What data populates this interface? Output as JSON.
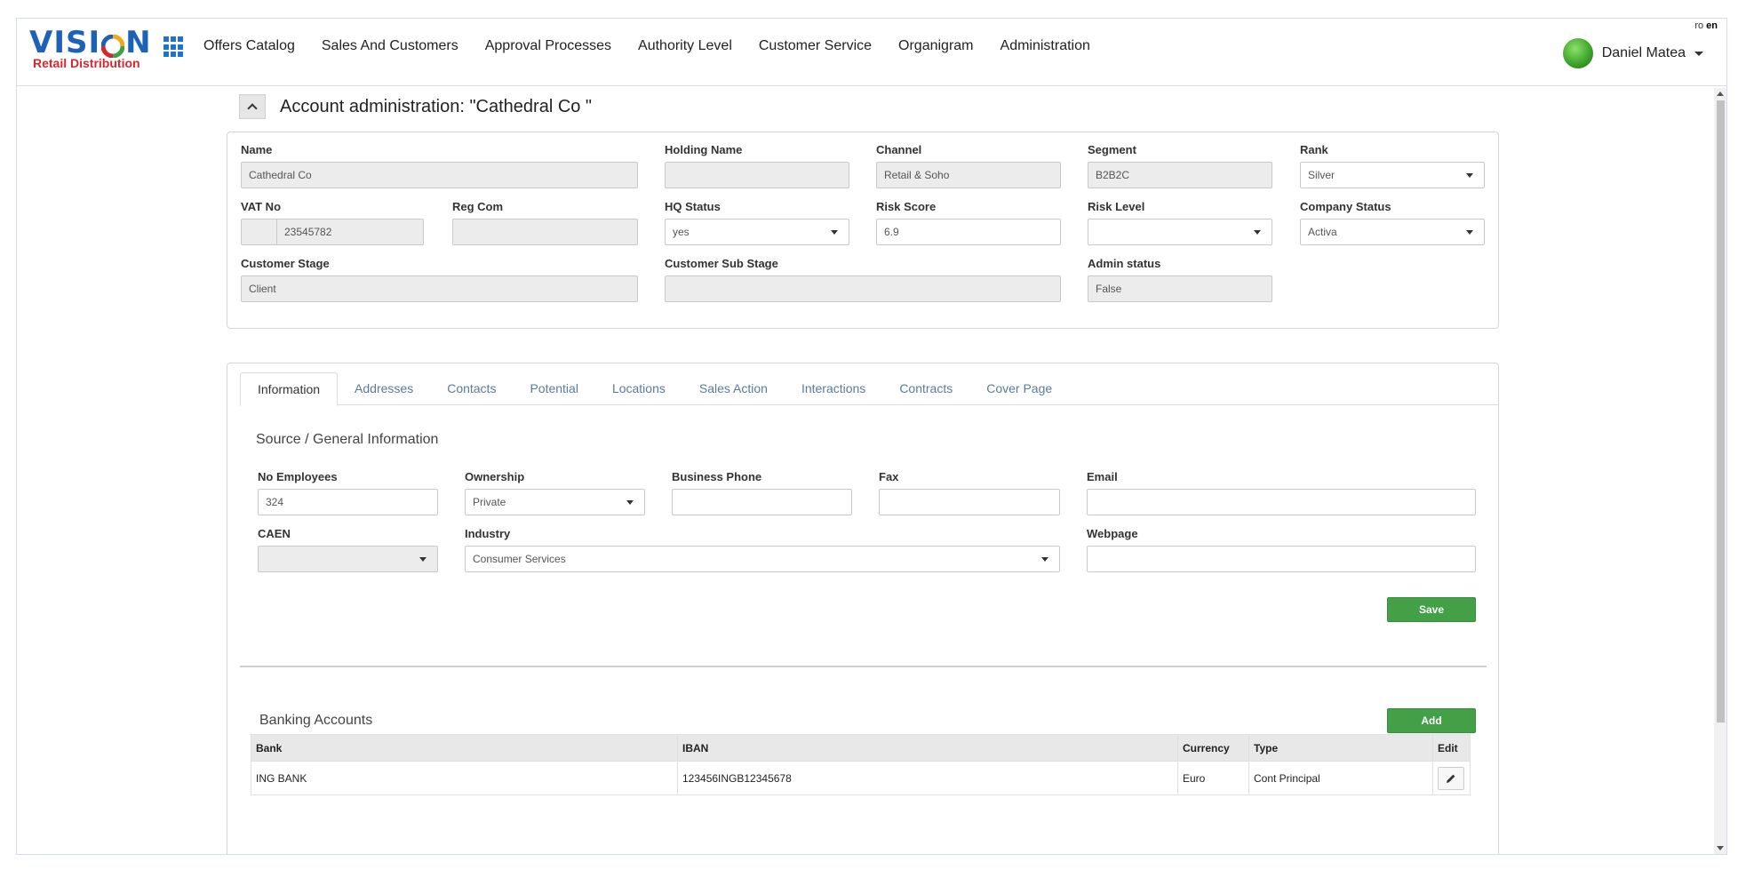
{
  "header": {
    "logo_text_left": "VISI",
    "logo_text_right": "N",
    "logo_subtitle": "Retail Distribution",
    "nav": [
      "Offers Catalog",
      "Sales And Customers",
      "Approval Processes",
      "Authority Level",
      "Customer Service",
      "Organigram",
      "Administration"
    ],
    "lang_ro": "ro",
    "lang_en": "en",
    "user_name": "Daniel Matea"
  },
  "page": {
    "title": "Account administration: \"Cathedral Co \""
  },
  "account": {
    "name_label": "Name",
    "name_value": "Cathedral Co",
    "holding_label": "Holding Name",
    "holding_value": "",
    "channel_label": "Channel",
    "channel_value": "Retail & Soho",
    "segment_label": "Segment",
    "segment_value": "B2B2C",
    "rank_label": "Rank",
    "rank_value": "Silver",
    "vat_label": "VAT No",
    "vat_value": "23545782",
    "regcom_label": "Reg Com",
    "regcom_value": "",
    "hq_label": "HQ Status",
    "hq_value": "yes",
    "risk_score_label": "Risk Score",
    "risk_score_value": "6.9",
    "risk_level_label": "Risk Level",
    "risk_level_value": "",
    "company_status_label": "Company Status",
    "company_status_value": "Activa",
    "stage_label": "Customer Stage",
    "stage_value": "Client",
    "substage_label": "Customer Sub Stage",
    "substage_value": "",
    "admin_label": "Admin status",
    "admin_value": "False"
  },
  "tabs": [
    "Information",
    "Addresses",
    "Contacts",
    "Potential",
    "Locations",
    "Sales Action",
    "Interactions",
    "Contracts",
    "Cover Page"
  ],
  "info": {
    "section_title": "Source / General Information",
    "employees_label": "No Employees",
    "employees_value": "324",
    "ownership_label": "Ownership",
    "ownership_value": "Private",
    "phone_label": "Business Phone",
    "phone_value": "",
    "fax_label": "Fax",
    "fax_value": "",
    "email_label": "Email",
    "email_value": "",
    "caen_label": "CAEN",
    "caen_value": "",
    "industry_label": "Industry",
    "industry_value": "Consumer Services",
    "webpage_label": "Webpage",
    "webpage_value": "",
    "save_label": "Save"
  },
  "banking": {
    "title": "Banking Accounts",
    "add_label": "Add",
    "columns": [
      "Bank",
      "IBAN",
      "Currency",
      "Type",
      "Edit"
    ],
    "rows": [
      {
        "bank": "ING BANK",
        "iban": "123456INGB12345678",
        "currency": "Euro",
        "type": "Cont Principal"
      }
    ]
  },
  "colors": {
    "brand_blue": "#1d62b9",
    "brand_red": "#d4282e",
    "button_green": "#43a047",
    "tab_link": "#5a7ba0"
  }
}
